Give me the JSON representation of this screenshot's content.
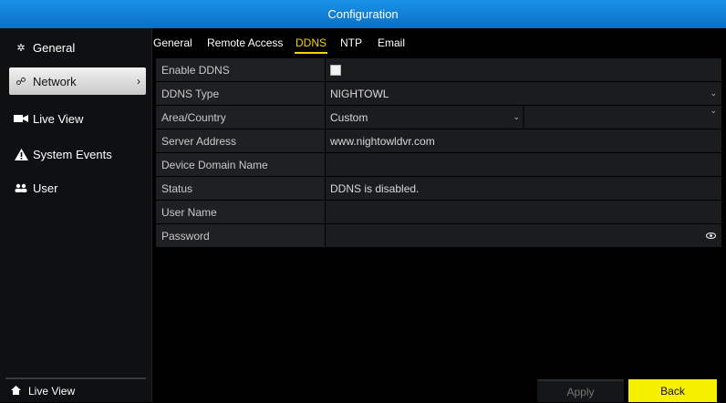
{
  "window": {
    "title": "Configuration"
  },
  "sidebar": {
    "items": [
      {
        "label": "General",
        "icon": "gear-icon"
      },
      {
        "label": "Network",
        "icon": "network-icon",
        "active": true
      },
      {
        "label": "Live View",
        "icon": "camera-icon"
      },
      {
        "label": "System Events",
        "icon": "warning-icon"
      },
      {
        "label": "User",
        "icon": "users-icon"
      }
    ],
    "bottom": {
      "label": "Live View",
      "icon": "home-icon"
    }
  },
  "tabs": [
    {
      "label": "General"
    },
    {
      "label": "Remote Access"
    },
    {
      "label": "DDNS",
      "active": true
    },
    {
      "label": "NTP"
    },
    {
      "label": "Email"
    }
  ],
  "form": {
    "enable_ddns": {
      "label": "Enable DDNS",
      "checked": true
    },
    "ddns_type": {
      "label": "DDNS Type",
      "value": "NIGHTOWL"
    },
    "area_country": {
      "label": "Area/Country",
      "value": "Custom",
      "value2": ""
    },
    "server_address": {
      "label": "Server Address",
      "value": "www.nightowldvr.com"
    },
    "device_domain_name": {
      "label": "Device Domain Name",
      "value": ""
    },
    "status": {
      "label": "Status",
      "value": "DDNS is disabled."
    },
    "user_name": {
      "label": "User Name",
      "value": ""
    },
    "password": {
      "label": "Password",
      "value": ""
    }
  },
  "buttons": {
    "apply": "Apply",
    "back": "Back"
  },
  "colors": {
    "titlebar": "#0a6fc4",
    "accent": "#f5d300",
    "back_button": "#f7ef00"
  }
}
